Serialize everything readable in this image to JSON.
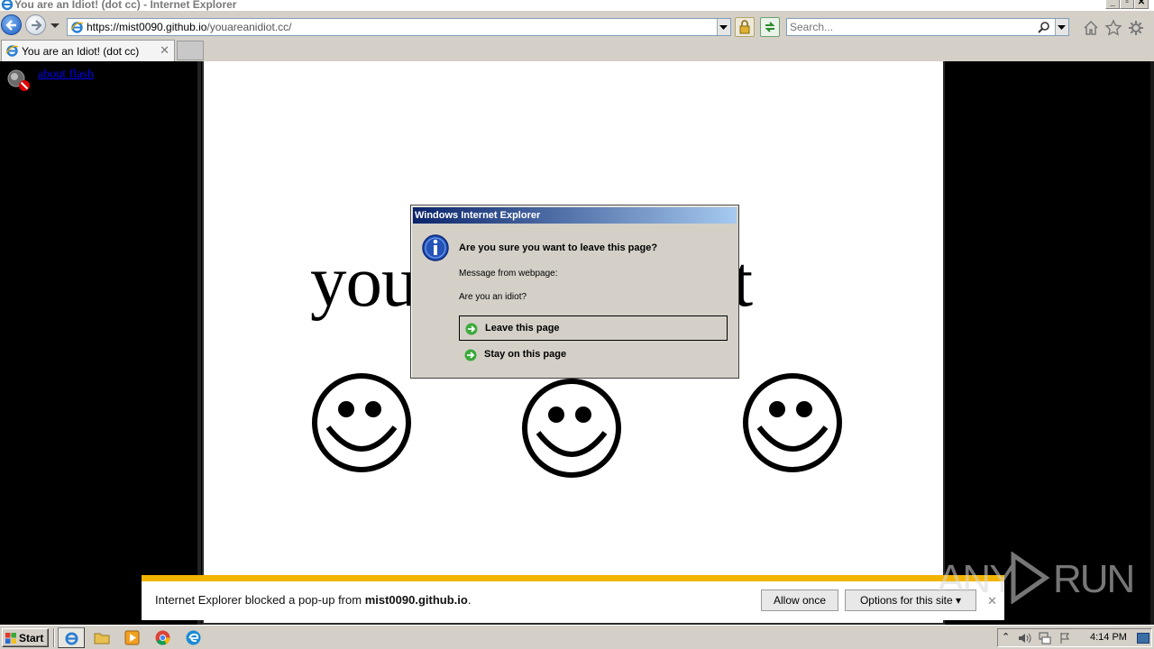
{
  "window": {
    "title": "You are an Idiot! (dot cc) - Internet Explorer",
    "caption_buttons": [
      "minimize",
      "restore",
      "close"
    ]
  },
  "navbar": {
    "address_host": "https://mist0090.github.io",
    "address_path": "/youareanidiot.cc/",
    "search_placeholder": "Search..."
  },
  "tabs": [
    {
      "title": "You are an Idiot! (dot cc)",
      "active": true
    }
  ],
  "content": {
    "plugin_link": "about flash",
    "headline": "you are an idiot",
    "smiley_count": 3
  },
  "dialog": {
    "title": "Windows Internet Explorer",
    "heading": "Are you sure you want to leave this page?",
    "message_label": "Message from webpage:",
    "message": "Are you an idiot?",
    "leave_label": "Leave this page",
    "stay_label": "Stay on this page"
  },
  "notification": {
    "text_prefix": "Internet Explorer blocked a pop-up from ",
    "site": "mist0090.github.io",
    "text_suffix": ".",
    "allow_label": "Allow once",
    "options_label": "Options for this site"
  },
  "watermark": {
    "left": "ANY",
    "right": "RUN"
  },
  "taskbar": {
    "start_label": "Start",
    "clock": "4:14 PM",
    "pinned": [
      "internet-explorer",
      "file-explorer",
      "media-player",
      "chrome",
      "edge"
    ]
  },
  "colors": {
    "dialog_title_start": "#0a246a",
    "dialog_title_end": "#a6caf0",
    "notify_accent": "#f2b400",
    "link": "#0000ee"
  }
}
